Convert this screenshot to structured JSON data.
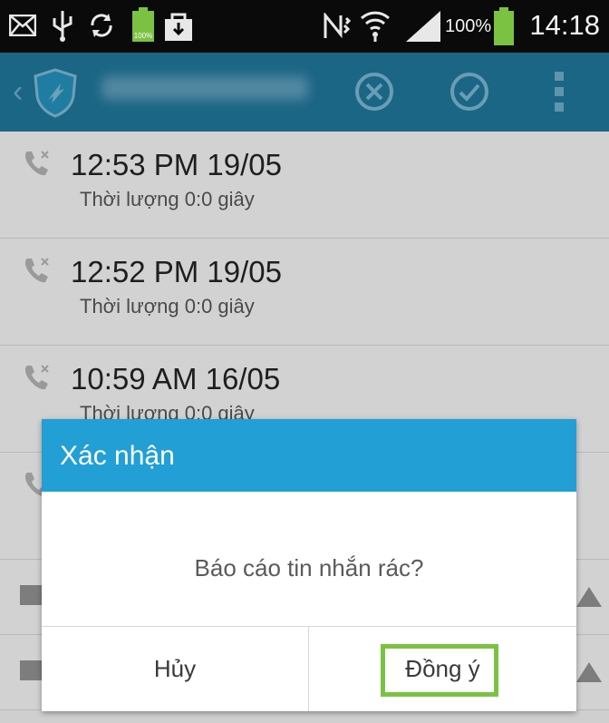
{
  "statusbar": {
    "battery_percent": "100%",
    "time": "14:18",
    "icons": [
      "mail-icon",
      "usb-icon",
      "sync-icon",
      "battery-100-small-icon",
      "shopping-bag-icon",
      "nfc-icon",
      "wifi-icon",
      "signal-icon",
      "battery-icon"
    ]
  },
  "appbar": {
    "icons": [
      "back-chevron-icon",
      "shield-app-icon",
      "cancel-circle-icon",
      "check-circle-icon",
      "overflow-menu-icon"
    ],
    "accent": "#1b6685"
  },
  "call_log": [
    {
      "time": "12:53 PM 19/05",
      "duration": "Thời lượng 0:0 giây"
    },
    {
      "time": "12:52 PM 19/05",
      "duration": "Thời lượng 0:0 giây"
    },
    {
      "time": "10:59 AM 16/05",
      "duration": "Thời lượng 0:0 giây"
    }
  ],
  "dialog": {
    "title": "Xác nhận",
    "message": "Báo cáo tin nhắn rác?",
    "cancel_label": "Hủy",
    "ok_label": "Đồng ý",
    "header_color": "#229fd5",
    "highlight_color": "#7cc242"
  }
}
